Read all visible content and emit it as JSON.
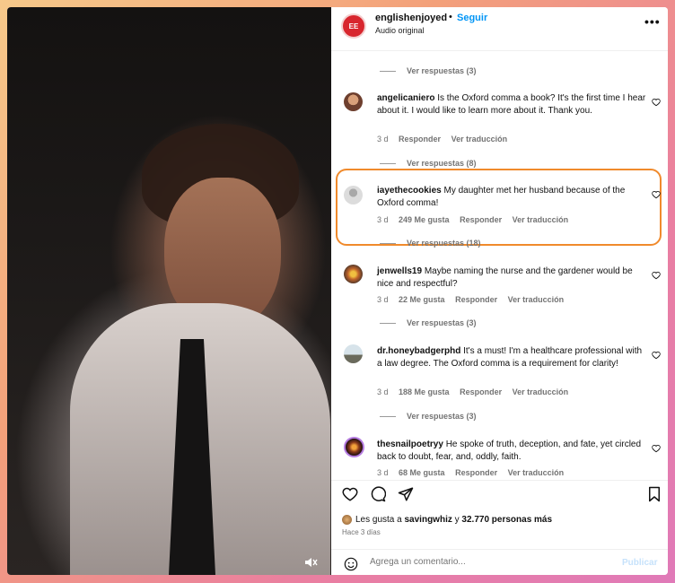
{
  "post": {
    "owner_username": "englishenjoyed",
    "owner_avatar_text": "EE",
    "separator": "•",
    "follow_label": "Seguir",
    "audio_label": "Audio original",
    "more_label": "•••"
  },
  "comments": [
    {
      "type": "replies",
      "label": "Ver respuestas (3)"
    },
    {
      "type": "comment",
      "username": "angelicaniero",
      "text": "Is the Oxford comma a book? It's the first time I hear about it. I would like to learn more about it. Thank you.",
      "age": "3 d",
      "likes": "",
      "reply": "Responder",
      "translate": "Ver traducción",
      "replies": "Ver respuestas (8)"
    },
    {
      "type": "comment",
      "username": "iayethecookies",
      "text": "My daughter met her husband because of the Oxford comma!",
      "age": "3 d",
      "likes": "249 Me gusta",
      "reply": "Responder",
      "translate": "Ver traducción",
      "replies": "Ver respuestas (18)",
      "highlighted": true
    },
    {
      "type": "comment",
      "username": "jenwells19",
      "text": "Maybe naming the nurse and the gardener would be nice and respectful?",
      "age": "3 d",
      "likes": "22 Me gusta",
      "reply": "Responder",
      "translate": "Ver traducción",
      "replies": "Ver respuestas (3)"
    },
    {
      "type": "comment",
      "username": "dr.honeybadgerphd",
      "text": "It's a must! I'm a healthcare professional with a law degree. The Oxford comma is a requirement for clarity!",
      "age": "3 d",
      "likes": "188 Me gusta",
      "reply": "Responder",
      "translate": "Ver traducción",
      "replies": "Ver respuestas (3)"
    },
    {
      "type": "comment",
      "username": "thesnailpoetryy",
      "text": "He spoke of truth, deception, and fate, yet circled back to doubt, fear, and, oddly, faith.",
      "age": "3 d",
      "likes": "68 Me gusta",
      "reply": "Responder",
      "translate": "Ver traducción"
    }
  ],
  "footer": {
    "likes_prefix": "Les gusta a",
    "likes_user": "savingwhiz",
    "likes_and": "y",
    "likes_count": "32.770 personas más",
    "time_ago": "Hace 3 días",
    "comment_placeholder": "Agrega un comentario...",
    "publish_label": "Publicar"
  },
  "icons": {
    "mute": "speaker-muted-icon",
    "heart": "heart-icon",
    "comment": "comment-bubble-icon",
    "share": "paper-plane-icon",
    "save": "bookmark-icon",
    "emoji": "emoji-icon",
    "more": "more-dots-icon"
  },
  "colors": {
    "accent": "#0095f6",
    "highlight": "#f08a2c",
    "owner_avatar": "#d8262e"
  }
}
